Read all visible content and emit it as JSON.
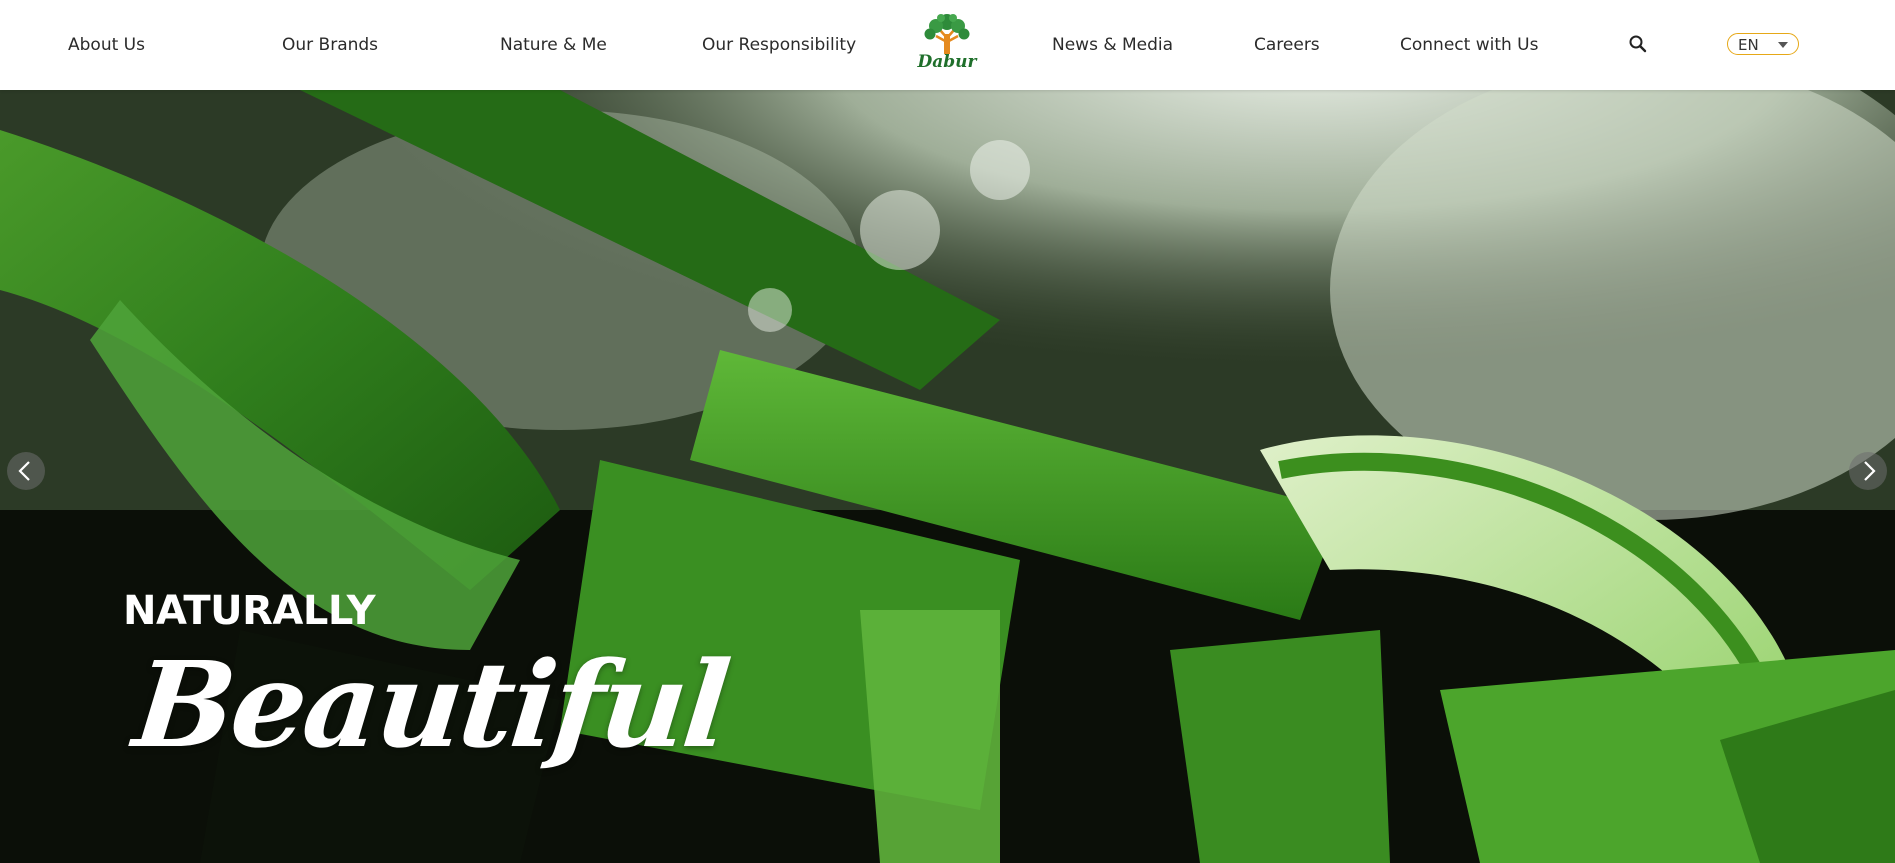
{
  "nav": {
    "left": [
      {
        "label": "About Us"
      },
      {
        "label": "Our Brands"
      },
      {
        "label": "Nature & Me"
      },
      {
        "label": "Our Responsibility"
      }
    ],
    "right": [
      {
        "label": "News & Media"
      },
      {
        "label": "Careers"
      },
      {
        "label": "Connect with Us"
      }
    ]
  },
  "logo": {
    "text": "Dabur",
    "icon": "tree-logo-icon"
  },
  "search": {
    "icon": "search-icon"
  },
  "language": {
    "selected": "EN",
    "icon": "chevron-down-icon"
  },
  "hero": {
    "tagline_small": "NATURALLY",
    "tagline_big": "Beautiful",
    "prev_icon": "chevron-left-icon",
    "next_icon": "chevron-right-icon"
  },
  "colors": {
    "accent_gold": "#e6a817",
    "logo_green": "#1f6f2b",
    "logo_orange": "#e58a1f",
    "header_bg": "#ffffff"
  }
}
